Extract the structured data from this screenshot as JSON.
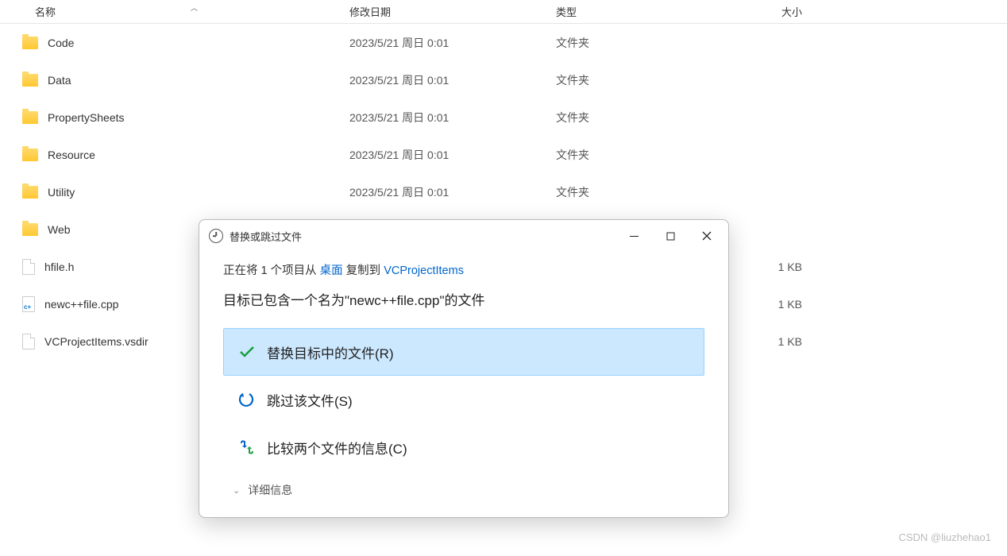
{
  "columns": {
    "name": "名称",
    "date": "修改日期",
    "type": "类型",
    "size": "大小"
  },
  "files": [
    {
      "icon": "folder",
      "name": "Code",
      "date": "2023/5/21 周日 0:01",
      "type": "文件夹",
      "size": ""
    },
    {
      "icon": "folder",
      "name": "Data",
      "date": "2023/5/21 周日 0:01",
      "type": "文件夹",
      "size": ""
    },
    {
      "icon": "folder",
      "name": "PropertySheets",
      "date": "2023/5/21 周日 0:01",
      "type": "文件夹",
      "size": ""
    },
    {
      "icon": "folder",
      "name": "Resource",
      "date": "2023/5/21 周日 0:01",
      "type": "文件夹",
      "size": ""
    },
    {
      "icon": "folder",
      "name": "Utility",
      "date": "2023/5/21 周日 0:01",
      "type": "文件夹",
      "size": ""
    },
    {
      "icon": "folder",
      "name": "Web",
      "date": "",
      "type": "",
      "size": ""
    },
    {
      "icon": "file",
      "name": "hfile.h",
      "date": "",
      "type": "",
      "size": "1 KB"
    },
    {
      "icon": "cpp",
      "name": "newc++file.cpp",
      "date": "",
      "type": "",
      "size": "1 KB"
    },
    {
      "icon": "file",
      "name": "VCProjectItems.vsdir",
      "date": "",
      "type": "",
      "size": "1 KB"
    }
  ],
  "dialog": {
    "title": "替换或跳过文件",
    "copying_prefix": "正在将 1 个项目从 ",
    "copying_source": "桌面",
    "copying_mid": " 复制到 ",
    "copying_dest": "VCProjectItems",
    "message": "目标已包含一个名为\"newc++file.cpp\"的文件",
    "option_replace": "替换目标中的文件(R)",
    "option_skip": "跳过该文件(S)",
    "option_compare": "比较两个文件的信息(C)",
    "details": "详细信息"
  },
  "watermark": "CSDN @liuzhehao1"
}
